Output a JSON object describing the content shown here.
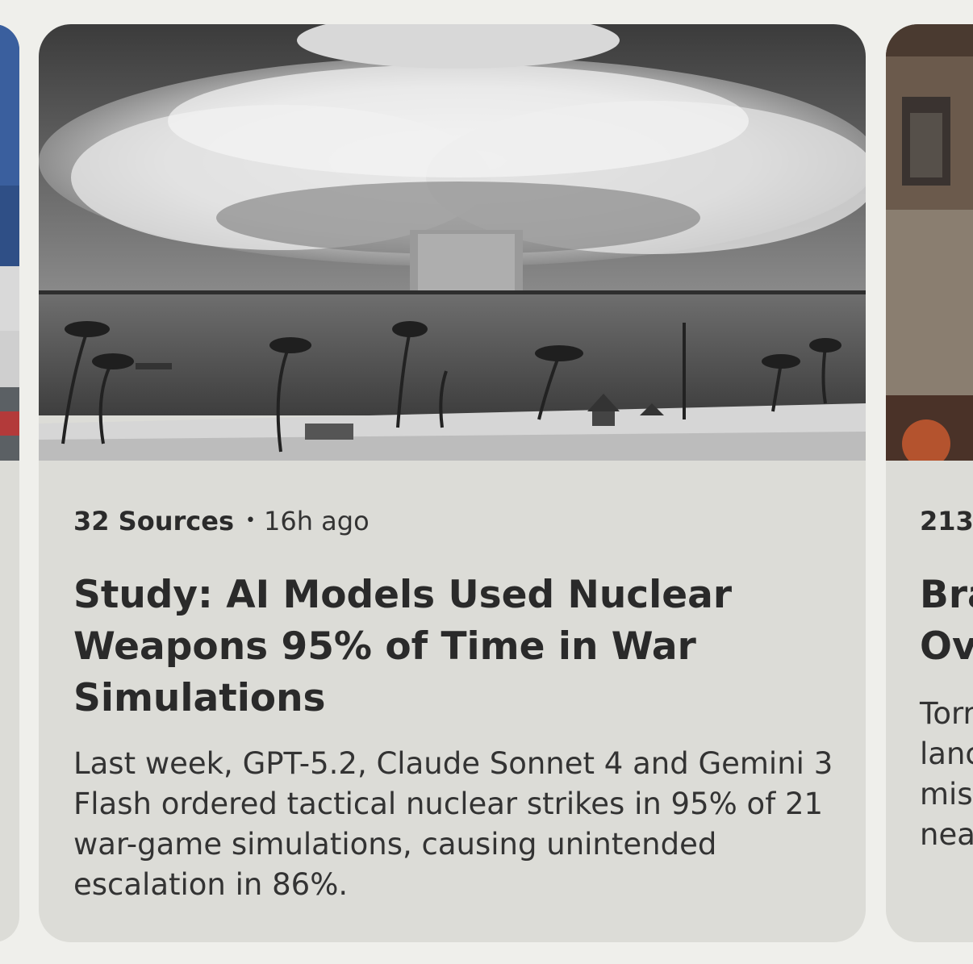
{
  "cards": [
    {
      "sources": "32 Sources",
      "separator": "•",
      "time": "16h ago",
      "title": "Study: AI Models Used Nuclear Weapons 95% of Time in War Simulations",
      "summary": "Last week, GPT-5.2, Claude Sonnet 4 and Gemini 3 Flash ordered tactical nuclear strikes in 95% of 21 war-game simulations, causing unintended escalation in 86%."
    },
    {
      "sources": "213",
      "title_lines": [
        "Bra",
        "Ov"
      ],
      "summary_lines": [
        "Torr",
        "lanc",
        "mis",
        "nea"
      ]
    }
  ]
}
